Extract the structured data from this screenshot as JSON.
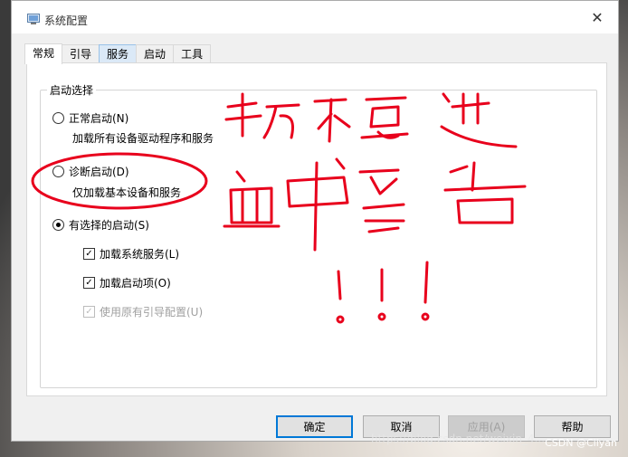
{
  "window": {
    "title": "系统配置",
    "close_glyph": "✕"
  },
  "tabs": [
    {
      "label": "常规"
    },
    {
      "label": "引导"
    },
    {
      "label": "服务"
    },
    {
      "label": "启动"
    },
    {
      "label": "工具"
    }
  ],
  "startup_group": {
    "label": "启动选择",
    "normal": {
      "label": "正常启动(N)",
      "desc": "加载所有设备驱动程序和服务",
      "selected": false
    },
    "diagnostic": {
      "label": "诊断启动(D)",
      "desc": "仅加载基本设备和服务",
      "selected": false
    },
    "selective": {
      "label": "有选择的启动(S)",
      "selected": true,
      "options": [
        {
          "label": "加载系统服务(L)",
          "checked": true,
          "enabled": true
        },
        {
          "label": "加载启动项(O)",
          "checked": true,
          "enabled": true
        },
        {
          "label": "使用原有引导配置(U)",
          "checked": true,
          "enabled": false
        }
      ]
    }
  },
  "buttons": {
    "ok": "确定",
    "cancel": "取消",
    "apply": "应用(A)",
    "help": "帮助"
  },
  "overlay": {
    "watermark": "https://blog.csdn.net/weixin_4...",
    "credit": "CSDN @Ciiyan",
    "ink_color": "#e8001c"
  }
}
